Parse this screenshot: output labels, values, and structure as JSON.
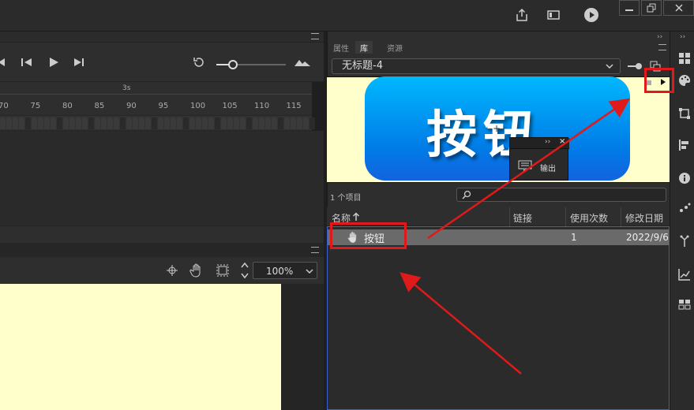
{
  "top_bar": {
    "icons": [
      "share-icon",
      "screen-mode-icon",
      "test-movie-play-icon"
    ],
    "window_buttons": [
      "minimize",
      "restore",
      "close"
    ]
  },
  "timeline": {
    "second_marker": "3s",
    "ticks": [
      "70",
      "75",
      "80",
      "85",
      "90",
      "95",
      "100",
      "105",
      "110",
      "115"
    ]
  },
  "stage": {
    "zoom_value": "100%"
  },
  "library_panel": {
    "tabs": [
      "属性",
      "库",
      "资源"
    ],
    "active_tab": "库",
    "document_name": "无标题-4",
    "preview_text": "按钮",
    "popup_label": "输出",
    "item_count": "1 个项目",
    "columns": {
      "name": "名称",
      "linkage": "链接",
      "use_count": "使用次数",
      "modified": "修改日期"
    },
    "items": [
      {
        "name": "按钮",
        "use_count": "1",
        "modified": "2022/9/6"
      }
    ]
  },
  "colors": {
    "annotation_red": "#e01a1a",
    "stage_bg": "#ffffcc",
    "button_blue": "#0099f2",
    "selection_border": "#3b5fd6"
  }
}
